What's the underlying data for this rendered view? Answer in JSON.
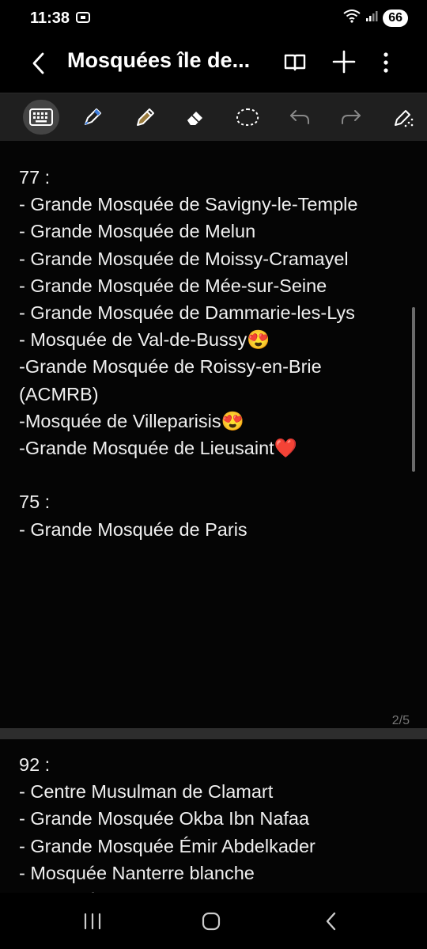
{
  "status": {
    "time": "11:38",
    "battery": "66"
  },
  "app_bar": {
    "title": "Mosquées île de..."
  },
  "toolbar": {
    "tools": [
      "keyboard",
      "pen",
      "highlighter",
      "eraser",
      "lasso",
      "undo",
      "redo",
      "pen-settings"
    ]
  },
  "note": {
    "page1_text": "77 :\n- Grande Mosquée de Savigny-le-Temple\n- Grande Mosquée de Melun\n- Grande Mosquée de Moissy-Cramayel\n- Grande Mosquée de Mée-sur-Seine\n- Grande Mosquée de Dammarie-les-Lys\n- Mosquée de Val-de-Bussy😍\n-Grande Mosquée de Roissy-en-Brie\n(ACMRB)\n-Mosquée de Villeparisis😍\n-Grande Mosquée de Lieusaint❤️\n\n75 :\n- Grande Mosquée de Paris",
    "page_indicator": "2/5",
    "page2_text": "92 :\n- Centre Musulman de Clamart\n- Grande Mosquée Okba Ibn Nafaa\n- Grande Mosquée Émir Abdelkader\n- Mosquée Nanterre blanche\n- Mosquée de Villeneuve-la-Garenne"
  }
}
